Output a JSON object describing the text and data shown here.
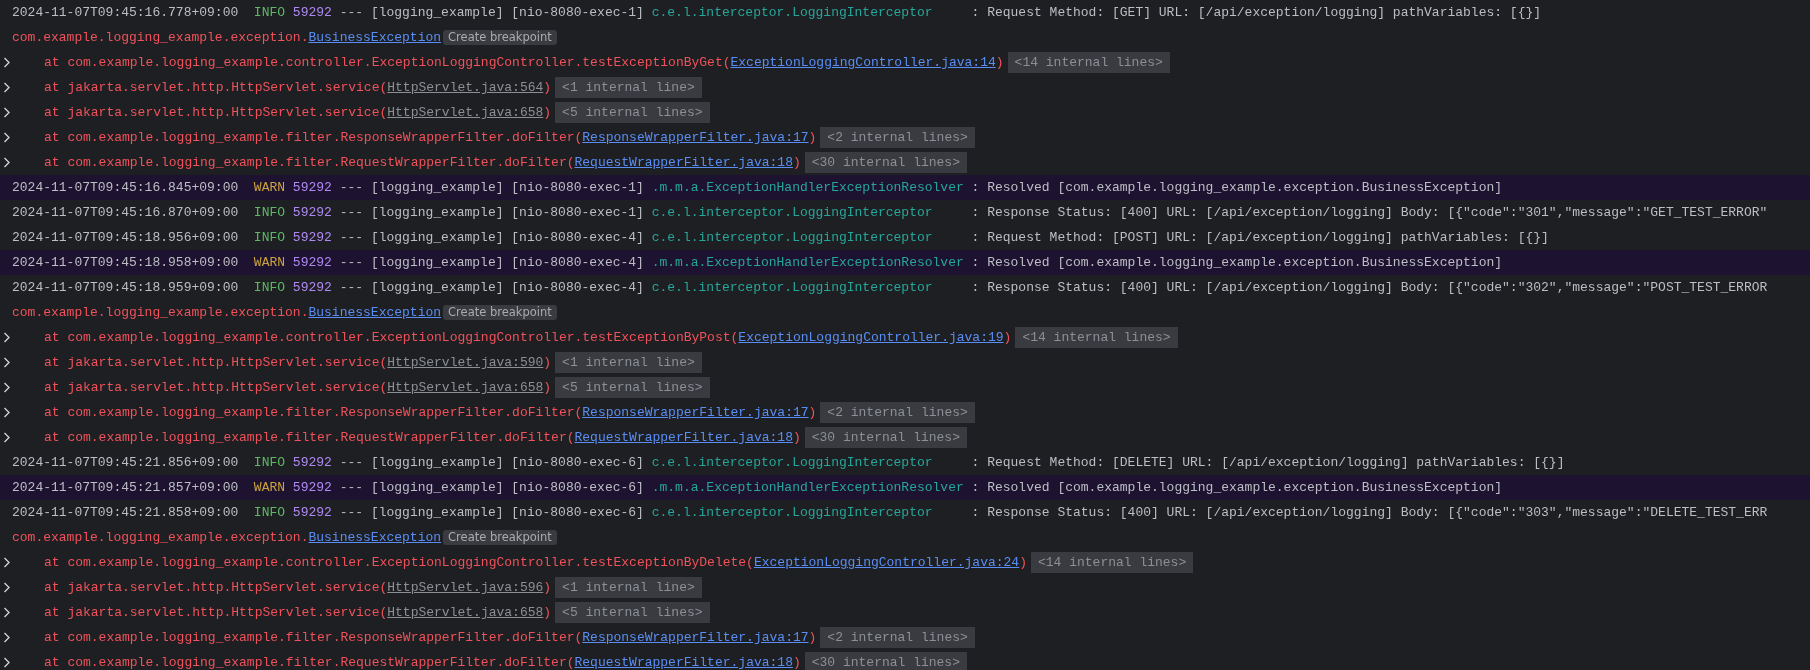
{
  "lines": [
    {
      "kind": "log",
      "timestamp": "2024-11-07T09:45:16.778+09:00",
      "level": {
        "text": "INFO",
        "kind": "info"
      },
      "pid": "59292",
      "separator": "---",
      "app": "[logging_example]",
      "thread": "[nio-8080-exec-1]",
      "logger": "c.e.l.interceptor.LoggingInterceptor",
      "message": ": Request Method: [GET] URL: [/api/exception/logging] pathVariables: [{}]"
    },
    {
      "kind": "exception",
      "package": "com.example.logging_example.exception.",
      "class": "BusinessException",
      "action": "Create breakpoint"
    },
    {
      "kind": "frame",
      "call": "at com.example.logging_example.controller.ExceptionLoggingController.testExceptionByGet(",
      "source": {
        "text": "ExceptionLoggingController.java:14",
        "kind": "project"
      },
      "close": ")",
      "folded": "<14 internal lines>"
    },
    {
      "kind": "frame",
      "call": "at jakarta.servlet.http.HttpServlet.service(",
      "source": {
        "text": "HttpServlet.java:564",
        "kind": "library"
      },
      "close": ")",
      "folded": "<1 internal line>"
    },
    {
      "kind": "frame",
      "call": "at jakarta.servlet.http.HttpServlet.service(",
      "source": {
        "text": "HttpServlet.java:658",
        "kind": "library"
      },
      "close": ")",
      "folded": "<5 internal lines>"
    },
    {
      "kind": "frame",
      "call": "at com.example.logging_example.filter.ResponseWrapperFilter.doFilter(",
      "source": {
        "text": "ResponseWrapperFilter.java:17",
        "kind": "project"
      },
      "close": ")",
      "folded": "<2 internal lines>"
    },
    {
      "kind": "frame",
      "call": "at com.example.logging_example.filter.RequestWrapperFilter.doFilter(",
      "source": {
        "text": "RequestWrapperFilter.java:18",
        "kind": "project"
      },
      "close": ")",
      "folded": "<30 internal lines>"
    },
    {
      "kind": "log",
      "timestamp": "2024-11-07T09:45:16.845+09:00",
      "level": {
        "text": "WARN",
        "kind": "warn"
      },
      "pid": "59292",
      "separator": "---",
      "app": "[logging_example]",
      "thread": "[nio-8080-exec-1]",
      "logger": ".m.m.a.ExceptionHandlerExceptionResolver",
      "message": ": Resolved [com.example.logging_example.exception.BusinessException]"
    },
    {
      "kind": "log",
      "timestamp": "2024-11-07T09:45:16.870+09:00",
      "level": {
        "text": "INFO",
        "kind": "info"
      },
      "pid": "59292",
      "separator": "---",
      "app": "[logging_example]",
      "thread": "[nio-8080-exec-1]",
      "logger": "c.e.l.interceptor.LoggingInterceptor",
      "message": ": Response Status: [400] URL: [/api/exception/logging] Body: [{\"code\":\"301\",\"message\":\"GET_TEST_ERROR\""
    },
    {
      "kind": "log",
      "timestamp": "2024-11-07T09:45:18.956+09:00",
      "level": {
        "text": "INFO",
        "kind": "info"
      },
      "pid": "59292",
      "separator": "---",
      "app": "[logging_example]",
      "thread": "[nio-8080-exec-4]",
      "logger": "c.e.l.interceptor.LoggingInterceptor",
      "message": ": Request Method: [POST] URL: [/api/exception/logging] pathVariables: [{}]"
    },
    {
      "kind": "log",
      "timestamp": "2024-11-07T09:45:18.958+09:00",
      "level": {
        "text": "WARN",
        "kind": "warn"
      },
      "pid": "59292",
      "separator": "---",
      "app": "[logging_example]",
      "thread": "[nio-8080-exec-4]",
      "logger": ".m.m.a.ExceptionHandlerExceptionResolver",
      "message": ": Resolved [com.example.logging_example.exception.BusinessException]"
    },
    {
      "kind": "log",
      "timestamp": "2024-11-07T09:45:18.959+09:00",
      "level": {
        "text": "INFO",
        "kind": "info"
      },
      "pid": "59292",
      "separator": "---",
      "app": "[logging_example]",
      "thread": "[nio-8080-exec-4]",
      "logger": "c.e.l.interceptor.LoggingInterceptor",
      "message": ": Response Status: [400] URL: [/api/exception/logging] Body: [{\"code\":\"302\",\"message\":\"POST_TEST_ERROR"
    },
    {
      "kind": "exception",
      "package": "com.example.logging_example.exception.",
      "class": "BusinessException",
      "action": "Create breakpoint"
    },
    {
      "kind": "frame",
      "call": "at com.example.logging_example.controller.ExceptionLoggingController.testExceptionByPost(",
      "source": {
        "text": "ExceptionLoggingController.java:19",
        "kind": "project"
      },
      "close": ")",
      "folded": "<14 internal lines>"
    },
    {
      "kind": "frame",
      "call": "at jakarta.servlet.http.HttpServlet.service(",
      "source": {
        "text": "HttpServlet.java:590",
        "kind": "library"
      },
      "close": ")",
      "folded": "<1 internal line>"
    },
    {
      "kind": "frame",
      "call": "at jakarta.servlet.http.HttpServlet.service(",
      "source": {
        "text": "HttpServlet.java:658",
        "kind": "library"
      },
      "close": ")",
      "folded": "<5 internal lines>"
    },
    {
      "kind": "frame",
      "call": "at com.example.logging_example.filter.ResponseWrapperFilter.doFilter(",
      "source": {
        "text": "ResponseWrapperFilter.java:17",
        "kind": "project"
      },
      "close": ")",
      "folded": "<2 internal lines>"
    },
    {
      "kind": "frame",
      "call": "at com.example.logging_example.filter.RequestWrapperFilter.doFilter(",
      "source": {
        "text": "RequestWrapperFilter.java:18",
        "kind": "project"
      },
      "close": ")",
      "folded": "<30 internal lines>"
    },
    {
      "kind": "log",
      "timestamp": "2024-11-07T09:45:21.856+09:00",
      "level": {
        "text": "INFO",
        "kind": "info"
      },
      "pid": "59292",
      "separator": "---",
      "app": "[logging_example]",
      "thread": "[nio-8080-exec-6]",
      "logger": "c.e.l.interceptor.LoggingInterceptor",
      "message": ": Request Method: [DELETE] URL: [/api/exception/logging] pathVariables: [{}]"
    },
    {
      "kind": "log",
      "timestamp": "2024-11-07T09:45:21.857+09:00",
      "level": {
        "text": "WARN",
        "kind": "warn"
      },
      "pid": "59292",
      "separator": "---",
      "app": "[logging_example]",
      "thread": "[nio-8080-exec-6]",
      "logger": ".m.m.a.ExceptionHandlerExceptionResolver",
      "message": ": Resolved [com.example.logging_example.exception.BusinessException]"
    },
    {
      "kind": "log",
      "timestamp": "2024-11-07T09:45:21.858+09:00",
      "level": {
        "text": "INFO",
        "kind": "info"
      },
      "pid": "59292",
      "separator": "---",
      "app": "[logging_example]",
      "thread": "[nio-8080-exec-6]",
      "logger": "c.e.l.interceptor.LoggingInterceptor",
      "message": ": Response Status: [400] URL: [/api/exception/logging] Body: [{\"code\":\"303\",\"message\":\"DELETE_TEST_ERR"
    },
    {
      "kind": "exception",
      "package": "com.example.logging_example.exception.",
      "class": "BusinessException",
      "action": "Create breakpoint"
    },
    {
      "kind": "frame",
      "call": "at com.example.logging_example.controller.ExceptionLoggingController.testExceptionByDelete(",
      "source": {
        "text": "ExceptionLoggingController.java:24",
        "kind": "project"
      },
      "close": ")",
      "folded": "<14 internal lines>"
    },
    {
      "kind": "frame",
      "call": "at jakarta.servlet.http.HttpServlet.service(",
      "source": {
        "text": "HttpServlet.java:596",
        "kind": "library"
      },
      "close": ")",
      "folded": "<1 internal line>"
    },
    {
      "kind": "frame",
      "call": "at jakarta.servlet.http.HttpServlet.service(",
      "source": {
        "text": "HttpServlet.java:658",
        "kind": "library"
      },
      "close": ")",
      "folded": "<5 internal lines>"
    },
    {
      "kind": "frame",
      "call": "at com.example.logging_example.filter.ResponseWrapperFilter.doFilter(",
      "source": {
        "text": "ResponseWrapperFilter.java:17",
        "kind": "project"
      },
      "close": ")",
      "folded": "<2 internal lines>"
    },
    {
      "kind": "frame",
      "call": "at com.example.logging_example.filter.RequestWrapperFilter.doFilter(",
      "source": {
        "text": "RequestWrapperFilter.java:18",
        "kind": "project"
      },
      "close": ")",
      "folded": "<30 internal lines>"
    }
  ]
}
